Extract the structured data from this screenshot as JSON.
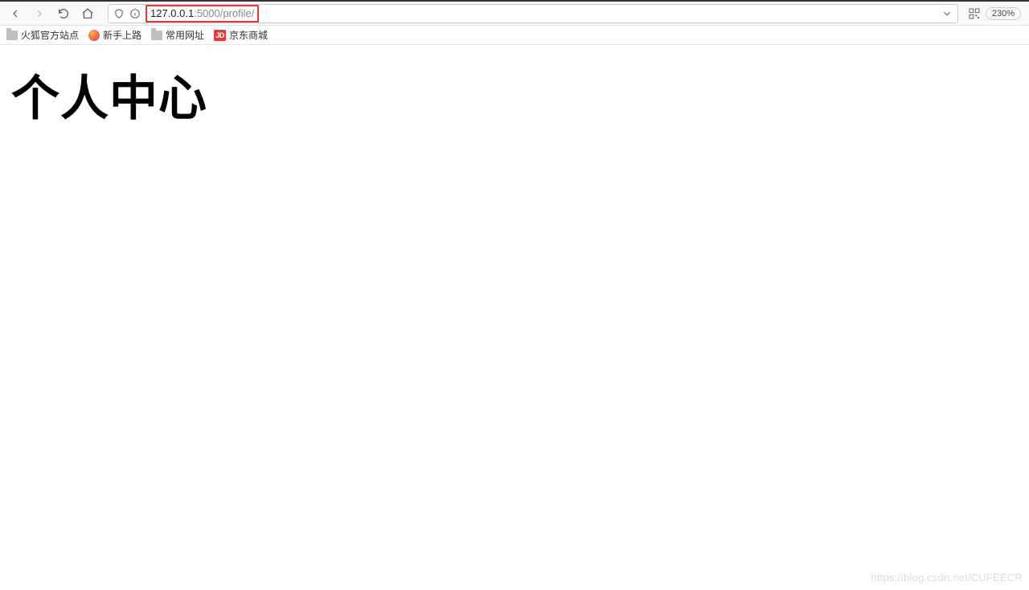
{
  "url": {
    "host_prefix": "127.0.0.1",
    "port_path": ":5000/profile/"
  },
  "zoom": {
    "level": "230%"
  },
  "bookmarks": {
    "items": [
      {
        "label": "火狐官方站点",
        "icon": "folder"
      },
      {
        "label": "新手上路",
        "icon": "firefox"
      },
      {
        "label": "常用网址",
        "icon": "folder"
      },
      {
        "label": "京东商城",
        "icon": "jd",
        "badge": "JD"
      }
    ]
  },
  "page": {
    "heading": "个人中心"
  },
  "watermark": "https://blog.csdn.net/CUFEECR"
}
